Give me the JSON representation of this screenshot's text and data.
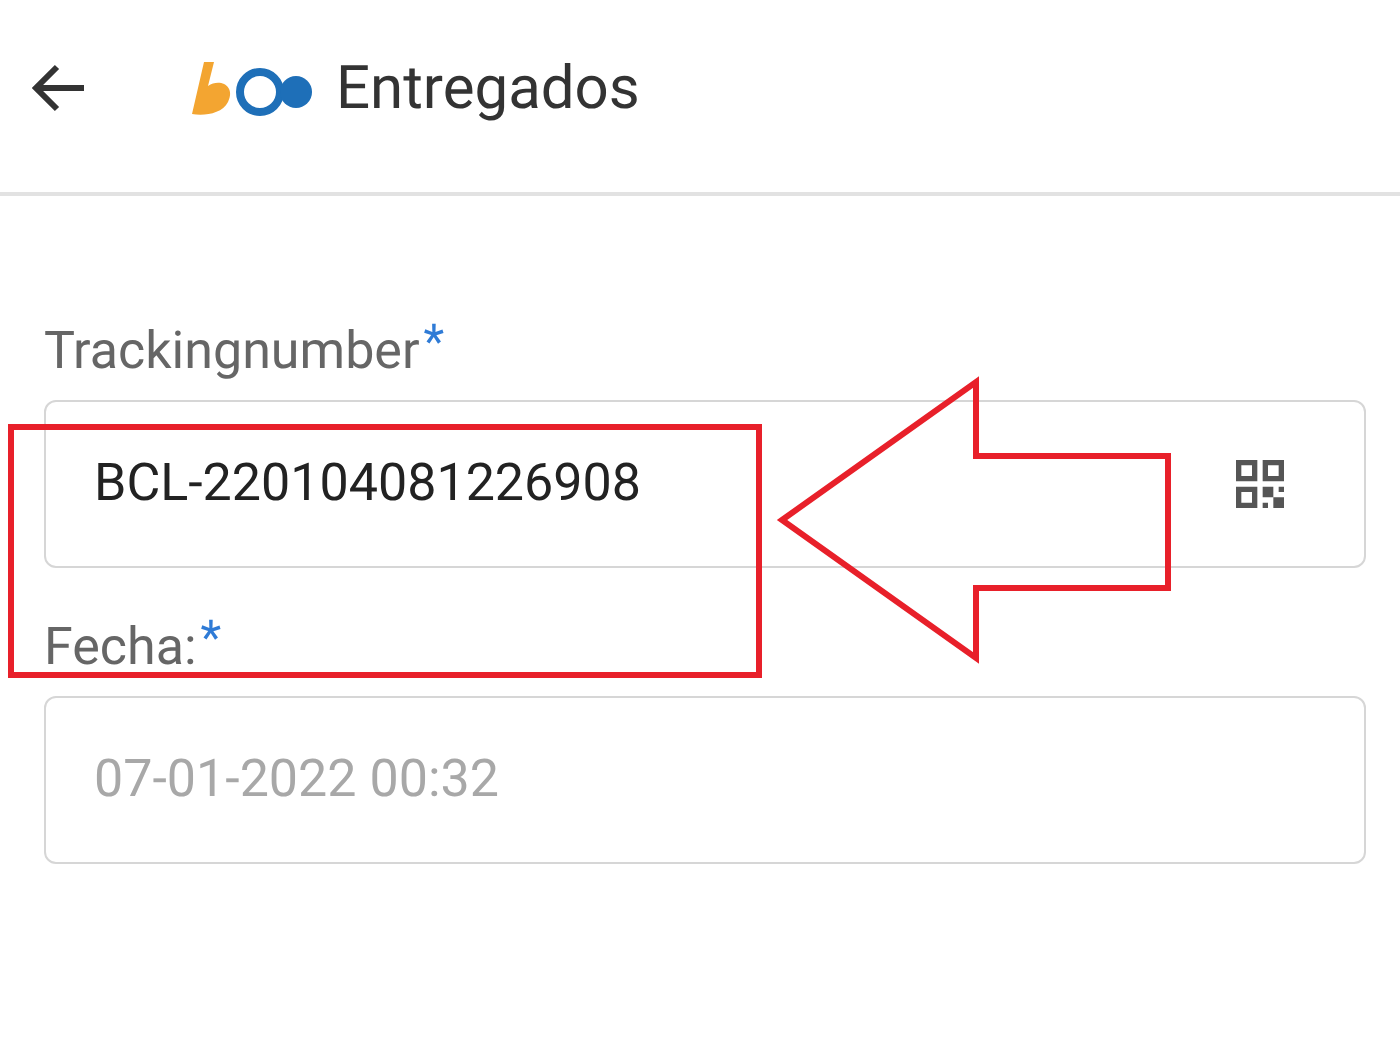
{
  "header": {
    "title": "Entregados"
  },
  "fields": [
    {
      "label": "Trackingnumber",
      "required": "*",
      "value": "BCL-220104081226908",
      "disabled": false,
      "scan": true
    },
    {
      "label": "Fecha:",
      "required": "*",
      "value": "07-01-2022 00:32",
      "disabled": true,
      "scan": false
    }
  ],
  "annotations": [
    {
      "kind": "highlight-box"
    },
    {
      "kind": "arrow"
    }
  ]
}
